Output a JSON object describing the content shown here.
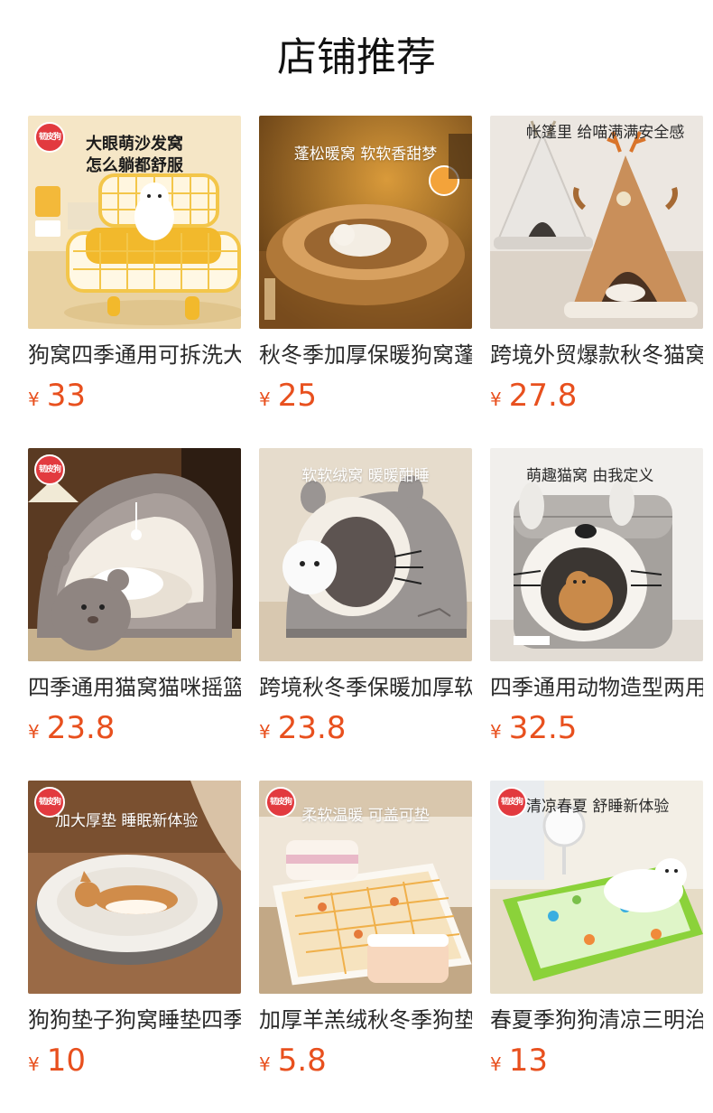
{
  "section_title": "店铺推荐",
  "currency_symbol": "¥",
  "colors": {
    "price": "#e8501e",
    "title": "#111111",
    "product_name": "#2a2a2a",
    "brand_badge": "#e23a3f"
  },
  "products": [
    {
      "name": "狗窝四季通用可拆洗大眼萌沙发窝",
      "price": "33",
      "image_caption": "大眼萌沙发窝\n怎么躺都舒服",
      "brand_badge": "韧皮狗"
    },
    {
      "name": "秋冬季加厚保暖狗窝蓬松暖窝",
      "price": "25",
      "image_caption": "蓬松暖窝 软软香甜梦"
    },
    {
      "name": "跨境外贸爆款秋冬猫窝帐篷",
      "price": "27.8",
      "image_caption": "帐篷里 给喵满满安全感"
    },
    {
      "name": "四季通用猫窝猫咪摇篮窝",
      "price": "23.8",
      "brand_badge": "韧皮狗"
    },
    {
      "name": "跨境秋冬季保暖加厚软软绒窝",
      "price": "23.8",
      "image_caption": "软软绒窝  暖暖酣睡"
    },
    {
      "name": "四季通用动物造型两用猫窝",
      "price": "32.5",
      "image_caption": "萌趣猫窝 由我定义"
    },
    {
      "name": "狗狗垫子狗窝睡垫四季通用",
      "price": "10",
      "image_caption": "加大厚垫 睡眠新体验",
      "brand_badge": "韧皮狗"
    },
    {
      "name": "加厚羊羔绒秋冬季狗垫毯子",
      "price": "5.8",
      "image_caption": "柔软温暖  可盖可垫",
      "brand_badge": "韧皮狗"
    },
    {
      "name": "春夏季狗狗清凉三明治冰垫",
      "price": "13",
      "image_caption": "清凉春夏 舒睡新体验",
      "brand_badge": "韧皮狗"
    }
  ]
}
